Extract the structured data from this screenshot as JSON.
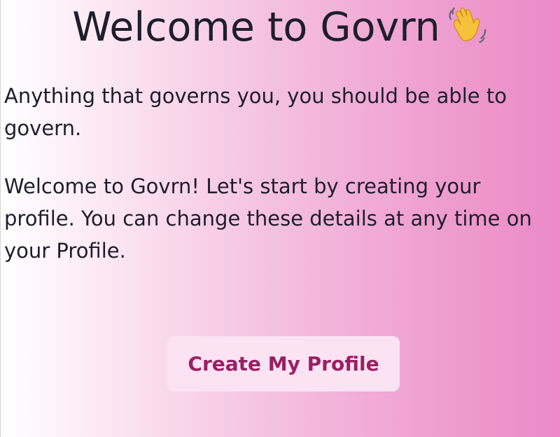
{
  "header": {
    "title": "Welcome to Govrn",
    "title_icon": "waving-hand-icon"
  },
  "main": {
    "tagline": "Anything that governs you, you should be able to govern.",
    "intro": "Welcome to Govrn! Let's start by creating your profile. You can change these details at any time on your Profile."
  },
  "actions": {
    "create_profile_label": "Create My Profile"
  },
  "colors": {
    "accent_text": "#9b1f62",
    "button_bg": "#fbe3f4",
    "gradient_end": "#ec8ac7"
  }
}
